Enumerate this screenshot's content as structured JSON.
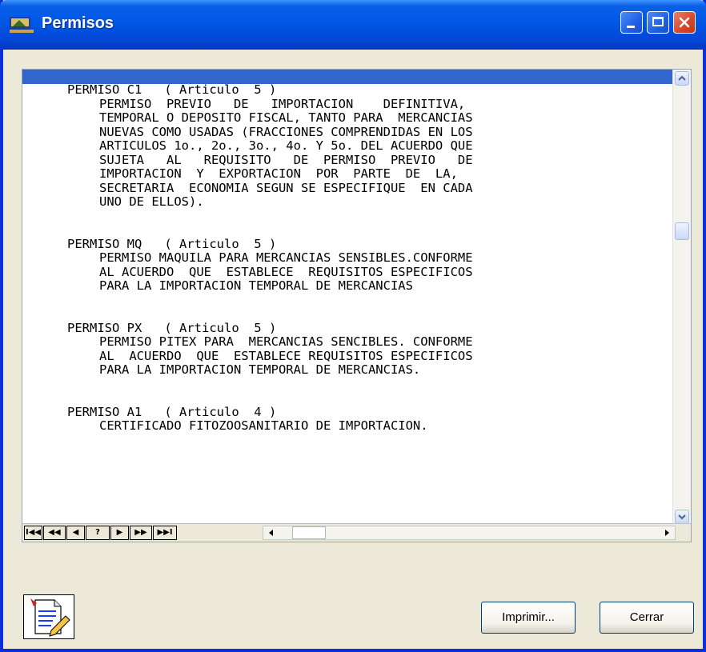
{
  "window": {
    "title": "Permisos",
    "icon": "app-icon"
  },
  "titlebar_buttons": [
    "minimize-icon",
    "maximize-icon",
    "close-icon"
  ],
  "report": {
    "entries": [
      {
        "code": "PERMISO C1",
        "article": "( Articulo  5 )",
        "lines": [
          "PERMISO  PREVIO   DE   IMPORTACION    DEFINITIVA,",
          "TEMPORAL O DEPOSITO FISCAL, TANTO PARA  MERCANCIAS",
          "NUEVAS COMO USADAS (FRACCIONES COMPRENDIDAS EN LOS",
          "ARTICULOS 1o., 2o., 3o., 4o. Y 5o. DEL ACUERDO QUE",
          "SUJETA   AL   REQUISITO   DE  PERMISO  PREVIO   DE",
          "IMPORTACION  Y  EXPORTACION  POR  PARTE  DE  LA,",
          "SECRETARIA  ECONOMIA SEGUN SE ESPECIFIQUE  EN CADA",
          "UNO DE ELLOS)."
        ]
      },
      {
        "code": "PERMISO MQ",
        "article": "( Articulo  5 )",
        "lines": [
          "PERMISO MAQUILA PARA MERCANCIAS SENSIBLES.CONFORME",
          "AL ACUERDO  QUE  ESTABLECE  REQUISITOS ESPECIFICOS",
          "PARA LA IMPORTACION TEMPORAL DE MERCANCIAS"
        ]
      },
      {
        "code": "PERMISO PX",
        "article": "( Articulo  5 )",
        "lines": [
          "PERMISO PITEX PARA  MERCANCIAS SENCIBLES. CONFORME",
          "AL  ACUERDO  QUE  ESTABLECE REQUISITOS ESPECIFICOS",
          "PARA LA IMPORTACION TEMPORAL DE MERCANCIAS."
        ]
      },
      {
        "code": "PERMISO A1",
        "article": "( Articulo  4 )",
        "lines": [
          "CERTIFICADO FITOZOOSANITARIO DE IMPORTACION."
        ]
      }
    ]
  },
  "navigation": {
    "first": "I◀◀",
    "prev_page": "◀◀",
    "prev": "◀",
    "page": "?",
    "next": "▶",
    "next_page": "▶▶",
    "last": "▶▶I"
  },
  "buttons": {
    "print": "Imprimir...",
    "close": "Cerrar"
  },
  "colors": {
    "titlebar": "#0058E6",
    "window_bg": "#ECE9D8",
    "report_header": "#3366CC"
  }
}
